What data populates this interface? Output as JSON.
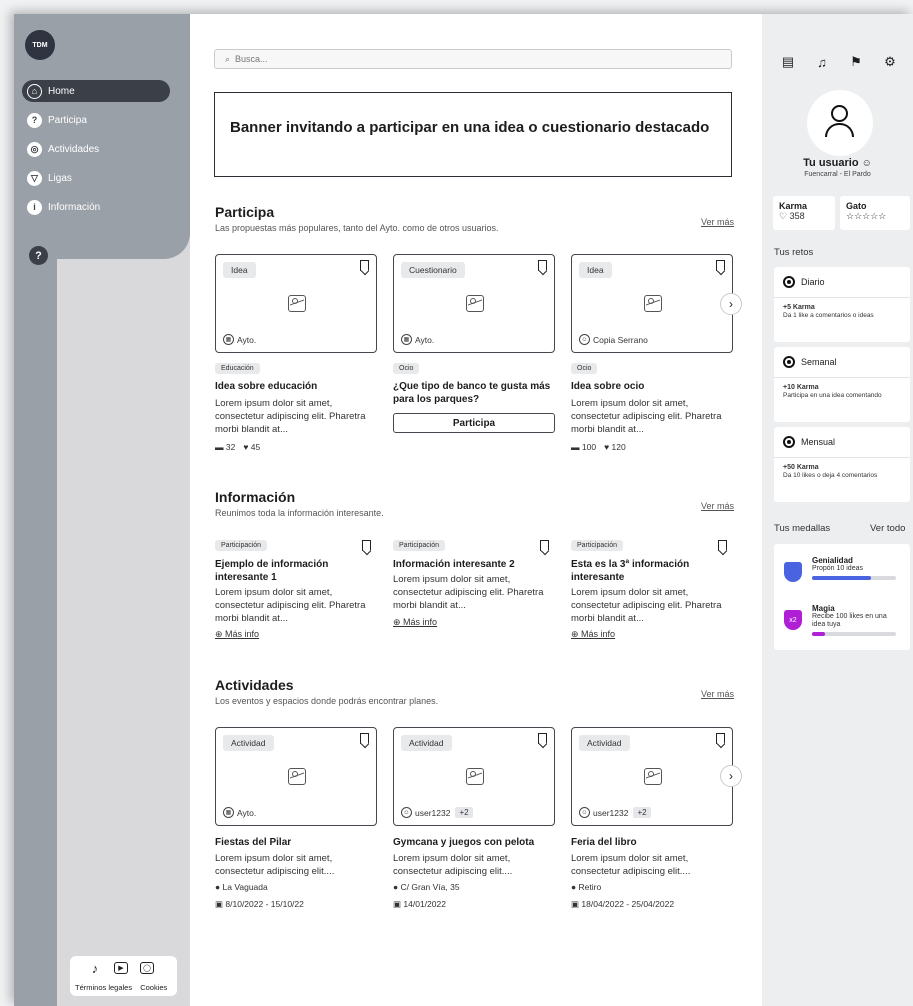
{
  "sidebar": {
    "logo": "TDM",
    "items": [
      {
        "label": "Home",
        "icon": "⌂"
      },
      {
        "label": "Participa",
        "icon": "?"
      },
      {
        "label": "Actividades",
        "icon": "◎"
      },
      {
        "label": "Ligas",
        "icon": "▽"
      },
      {
        "label": "Información",
        "icon": "i"
      }
    ],
    "help_icon": "?",
    "footer": {
      "legal": "Términos legales",
      "cookies": "Cookies"
    }
  },
  "search": {
    "placeholder": "Busca..."
  },
  "banner": {
    "text": "Banner invitando a participar en una idea o cuestionario destacado"
  },
  "participa": {
    "title": "Participa",
    "subtitle": "Las propuestas más populares, tanto del Ayto. como de otros usuarios.",
    "ver_mas": "Ver más",
    "cards": [
      {
        "tag": "Idea",
        "author": "Ayto.",
        "category": "Educación",
        "title": "Idea sobre educación",
        "desc": "Lorem ipsum dolor sit amet, consectetur adipiscing elit. Pharetra morbi blandit at...",
        "comments": "32",
        "likes": "45"
      },
      {
        "tag": "Cuestionario",
        "author": "Ayto.",
        "category": "Ocio",
        "title": "¿Que tipo de banco te gusta más para los parques?",
        "button": "Participa"
      },
      {
        "tag": "Idea",
        "author": "Copia Serrano",
        "category": "Ocio",
        "title": "Idea sobre ocio",
        "desc": "Lorem ipsum dolor sit amet, consectetur adipiscing elit. Pharetra morbi blandit at...",
        "comments": "100",
        "likes": "120"
      }
    ]
  },
  "informacion": {
    "title": "Información",
    "subtitle": "Reunimos toda la información interesante.",
    "ver_mas": "Ver más",
    "cards": [
      {
        "category": "Participación",
        "title": "Ejemplo de información interesante 1",
        "desc": "Lorem ipsum dolor sit amet, consectetur adipiscing elit. Pharetra morbi blandit at...",
        "link": "Más info"
      },
      {
        "category": "Participación",
        "title": "Información interesante 2",
        "desc": "Lorem ipsum dolor sit amet, consectetur adipiscing elit. Pharetra morbi blandit at...",
        "link": "Más info"
      },
      {
        "category": "Participación",
        "title": "Esta es la 3ª información interesante",
        "desc": "Lorem ipsum dolor sit amet, consectetur adipiscing elit. Pharetra morbi blandit at...",
        "link": "Más info"
      }
    ]
  },
  "actividades": {
    "title": "Actividades",
    "subtitle": "Los eventos y espacios donde podrás encontrar planes.",
    "ver_mas": "Ver más",
    "cards": [
      {
        "tag": "Actividad",
        "author": "Ayto.",
        "title": "Fiestas del Pilar",
        "desc": "Lorem ipsum dolor sit amet, consectetur adipiscing elit....",
        "place": "La Vaguada",
        "dates": "8/10/2022 - 15/10/22"
      },
      {
        "tag": "Actividad",
        "author": "user1232",
        "extra": "+2",
        "title": "Gymcana y juegos con pelota",
        "desc": "Lorem ipsum dolor sit amet, consectetur adipiscing elit....",
        "place": "C/ Gran Vía, 35",
        "dates": "14/01/2022"
      },
      {
        "tag": "Actividad",
        "author": "user1232",
        "extra": "+2",
        "title": "Feria del libro",
        "desc": "Lorem ipsum dolor sit amet, consectetur adipiscing elit....",
        "place": "Retiro",
        "dates": "18/04/2022 - 25/04/2022"
      }
    ]
  },
  "profile": {
    "name": "Tu usuario",
    "location": "Fuencarral - El Pardo",
    "karma_label": "Karma",
    "karma_value": "358",
    "league_label": "Gato",
    "league_stars": "☆☆☆☆☆"
  },
  "retos": {
    "title": "Tus retos",
    "items": [
      {
        "period": "Diario",
        "reward": "+5 Karma",
        "desc": "Da 1 like a comentarios o ideas"
      },
      {
        "period": "Semanal",
        "reward": "+10 Karma",
        "desc": "Participa en una idea comentando"
      },
      {
        "period": "Mensual",
        "reward": "+50 Karma",
        "desc": "Da 10 likes o deja 4 comentarios"
      }
    ]
  },
  "medallas": {
    "title": "Tus medallas",
    "ver_todo": "Ver todo",
    "items": [
      {
        "name": "Genialidad",
        "desc": "Propón 10 ideas",
        "progress": 0.7,
        "color": "#4a63e0"
      },
      {
        "name": "Magia",
        "desc": "Recibe 100 likes en una idea tuya",
        "progress": 0.15,
        "color": "#b01fd6",
        "badge": "x2"
      }
    ]
  }
}
